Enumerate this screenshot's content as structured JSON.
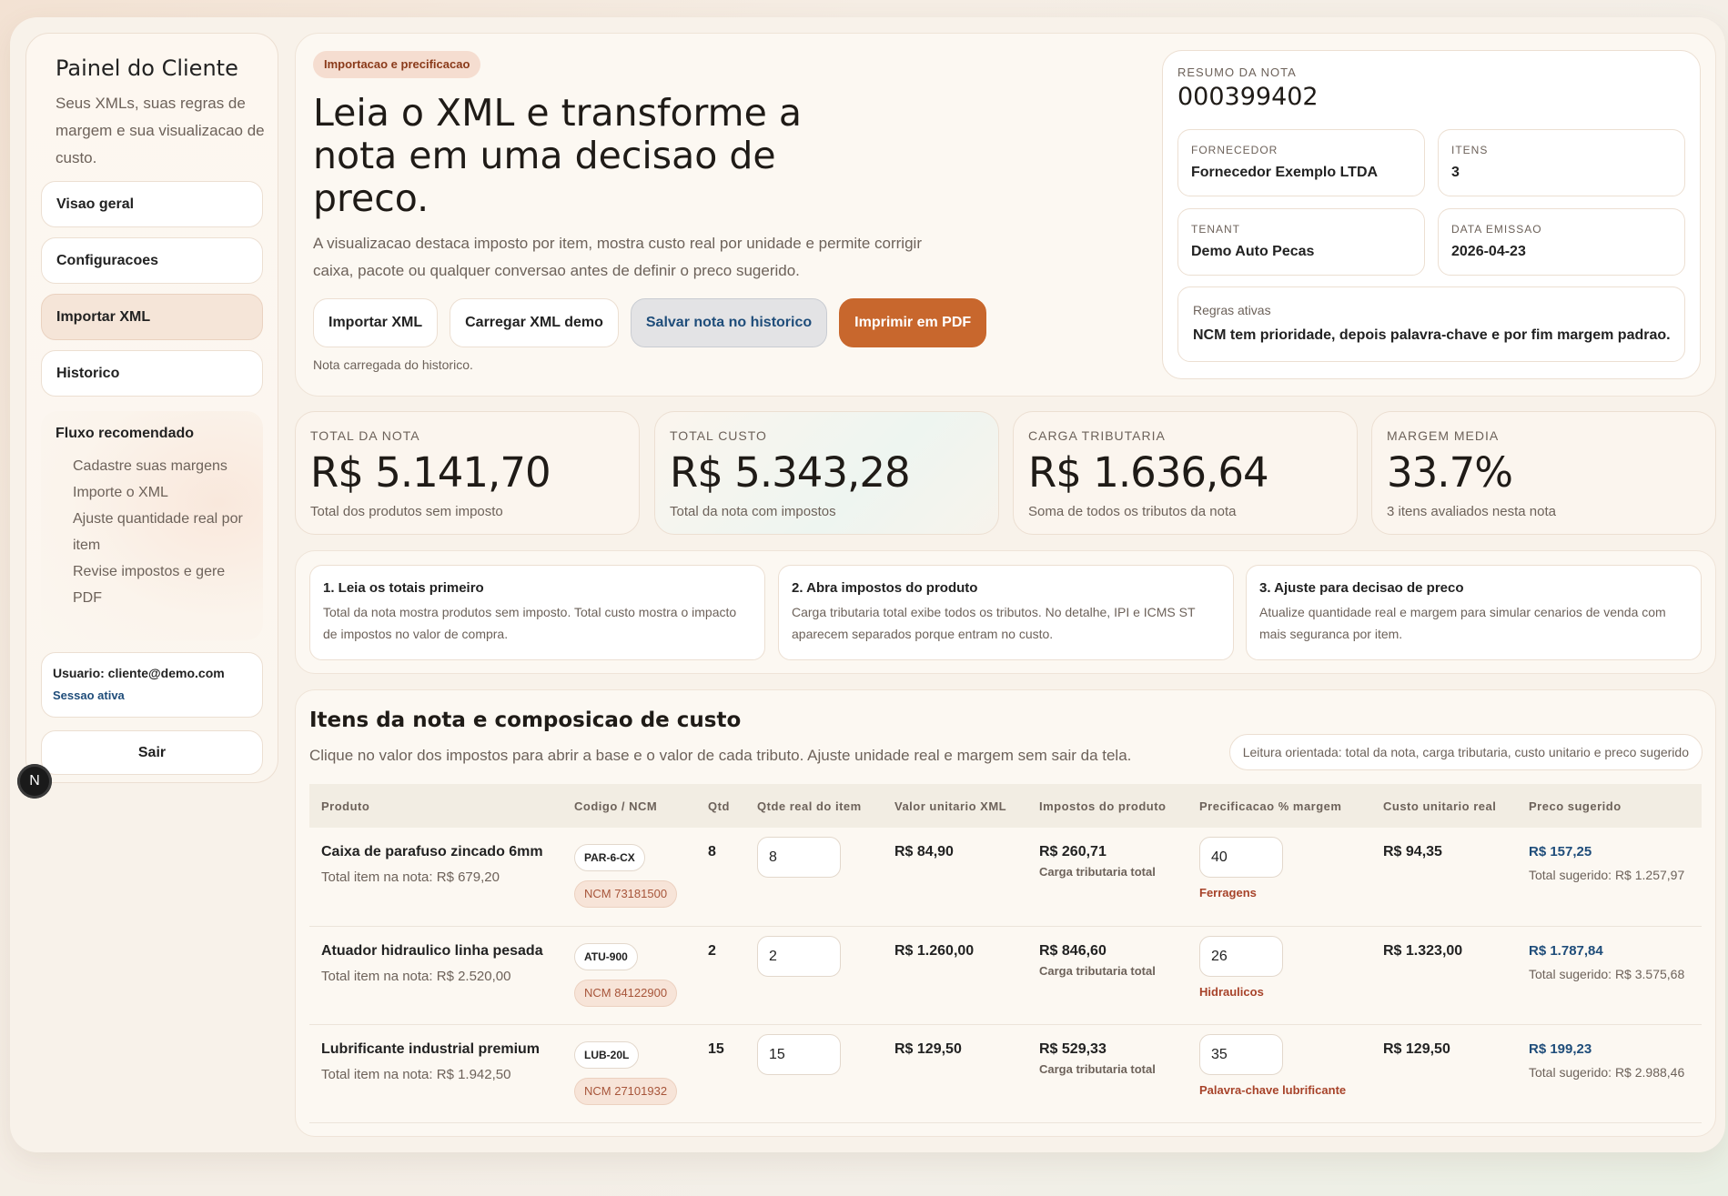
{
  "sidebar": {
    "title": "Painel do Cliente",
    "subtitle": "Seus XMLs, suas regras de margem e sua visualizacao de custo.",
    "nav": [
      {
        "label": "Visao geral"
      },
      {
        "label": "Configuracoes"
      },
      {
        "label": "Importar XML",
        "active": true
      },
      {
        "label": "Historico"
      }
    ],
    "flow": {
      "title": "Fluxo recomendado",
      "steps": [
        "Cadastre suas margens",
        "Importe o XML",
        "Ajuste quantidade real por item",
        "Revise impostos e gere PDF"
      ]
    },
    "user": {
      "label": "Usuario: cliente@demo.com",
      "status": "Sessao ativa"
    },
    "logout": "Sair",
    "badge": "N"
  },
  "hero": {
    "pill": "Importacao e precificacao",
    "heading": "Leia o XML e transforme a nota em uma decisao de preco.",
    "paragraph": "A visualizacao destaca imposto por item, mostra custo real por unidade e permite corrigir caixa, pacote ou qualquer conversao antes de definir o preco sugerido.",
    "buttons": {
      "import": "Importar XML",
      "demo": "Carregar XML demo",
      "save": "Salvar nota no historico",
      "pdf": "Imprimir em PDF"
    },
    "note": "Nota carregada do historico."
  },
  "summary": {
    "label": "RESUMO DA NOTA",
    "number": "000399402",
    "supplier_label": "FORNECEDOR",
    "supplier": "Fornecedor Exemplo LTDA",
    "items_label": "ITENS",
    "items": "3",
    "tenant_label": "TENANT",
    "tenant": "Demo Auto Pecas",
    "date_label": "DATA EMISSAO",
    "date": "2026-04-23",
    "rules_label": "Regras ativas",
    "rules": "NCM tem prioridade, depois palavra-chave e por fim margem padrao."
  },
  "kpis": [
    {
      "label": "TOTAL DA NOTA",
      "value": "R$ 5.141,70",
      "sub": "Total dos produtos sem imposto"
    },
    {
      "label": "TOTAL CUSTO",
      "value": "R$ 5.343,28",
      "sub": "Total da nota com impostos"
    },
    {
      "label": "CARGA TRIBUTARIA",
      "value": "R$ 1.636,64",
      "sub": "Soma de todos os tributos da nota"
    },
    {
      "label": "MARGEM MEDIA",
      "value": "33.7%",
      "sub": "3 itens avaliados nesta nota"
    }
  ],
  "steps": [
    {
      "title": "1. Leia os totais primeiro",
      "text": "Total da nota mostra produtos sem imposto. Total custo mostra o impacto de impostos no valor de compra."
    },
    {
      "title": "2. Abra impostos do produto",
      "text": "Carga tributaria total exibe todos os tributos. No detalhe, IPI e ICMS ST aparecem separados porque entram no custo."
    },
    {
      "title": "3. Ajuste para decisao de preco",
      "text": "Atualize quantidade real e margem para simular cenarios de venda com mais seguranca por item."
    }
  ],
  "items": {
    "title": "Itens da nota e composicao de custo",
    "subtitle": "Clique no valor dos impostos para abrir a base e o valor de cada tributo. Ajuste unidade real e margem sem sair da tela.",
    "hint": "Leitura orientada: total da nota, carga tributaria, custo unitario e preco sugerido",
    "columns": [
      "Produto",
      "Codigo / NCM",
      "Qtd",
      "Qtde real do item",
      "Valor unitario XML",
      "Impostos do produto",
      "Precificacao % margem",
      "Custo unitario real",
      "Preco sugerido"
    ],
    "rows": [
      {
        "name": "Caixa de parafuso zincado 6mm",
        "total": "Total item na nota: R$ 679,20",
        "code": "PAR-6-CX",
        "ncm": "NCM 73181500",
        "qtd": "8",
        "qtd_real": "8",
        "unit": "R$ 84,90",
        "tax": "R$ 260,71",
        "tax_label": "Carga tributaria total",
        "margin": "40",
        "rule": "Ferragens",
        "cost": "R$ 94,35",
        "price": "R$ 157,25",
        "price_total": "Total sugerido: R$ 1.257,97"
      },
      {
        "name": "Atuador hidraulico linha pesada",
        "total": "Total item na nota: R$ 2.520,00",
        "code": "ATU-900",
        "ncm": "NCM 84122900",
        "qtd": "2",
        "qtd_real": "2",
        "unit": "R$ 1.260,00",
        "tax": "R$ 846,60",
        "tax_label": "Carga tributaria total",
        "margin": "26",
        "rule": "Hidraulicos",
        "cost": "R$ 1.323,00",
        "price": "R$ 1.787,84",
        "price_total": "Total sugerido: R$ 3.575,68"
      },
      {
        "name": "Lubrificante industrial premium",
        "total": "Total item na nota: R$ 1.942,50",
        "code": "LUB-20L",
        "ncm": "NCM 27101932",
        "qtd": "15",
        "qtd_real": "15",
        "unit": "R$ 129,50",
        "tax": "R$ 529,33",
        "tax_label": "Carga tributaria total",
        "margin": "35",
        "rule": "Palavra-chave lubrificante",
        "cost": "R$ 129,50",
        "price": "R$ 199,23",
        "price_total": "Total sugerido: R$ 2.988,46"
      }
    ]
  }
}
